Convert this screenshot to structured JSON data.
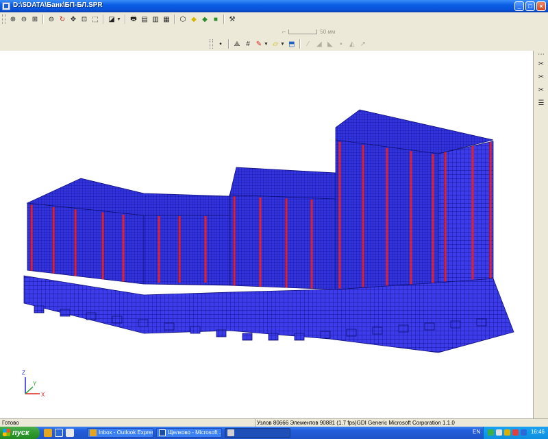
{
  "window": {
    "title": "D:\\SDATA\\Банк\\БП-БЛ.SPR"
  },
  "toolbar": {
    "scale_label": "50 мм"
  },
  "status": {
    "left": "Готово",
    "info": "Узлов 80666  Элементов 90881  (1.7 fps)GDI Generic Microsoft Corporation 1.1.0"
  },
  "axes": {
    "z": "Z",
    "y": "Y",
    "x": "X"
  },
  "taskbar": {
    "start_label": "пуск",
    "tasks": [
      {
        "label": "Inbox - Outlook Express"
      },
      {
        "label": "Щелково - Microsoft ..."
      },
      {
        "label": ""
      }
    ],
    "lang": "EN",
    "clock": "16:46"
  },
  "colors": {
    "mesh": "#2b2bd6",
    "mesh_dark": "#101078",
    "columns": "#e0202a",
    "titlebar": "#0a5ee6",
    "taskbar": "#245edb",
    "start": "#2f9a2f",
    "axis_x": "#e02020",
    "axis_y": "#20a020",
    "axis_z": "#2020e0"
  }
}
